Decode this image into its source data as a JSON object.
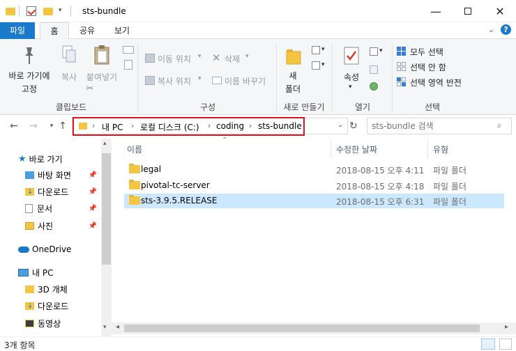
{
  "window": {
    "title": "sts-bundle",
    "controls": [
      "minimize",
      "maximize",
      "close"
    ]
  },
  "ribbon_tabs": [
    {
      "label": "파일",
      "active": false,
      "accent": true
    },
    {
      "label": "홈",
      "active": true
    },
    {
      "label": "공유",
      "active": false
    },
    {
      "label": "보기",
      "active": false
    }
  ],
  "ribbon": {
    "clipboard": {
      "pin_label_1": "바로 가기에",
      "pin_label_2": "고정",
      "copy": "복사",
      "paste": "붙여넣기",
      "group": "클립보드"
    },
    "organize": {
      "move_to": "이동 위치",
      "copy_to": "복사 위치",
      "delete": "삭제",
      "rename": "이름 바꾸기",
      "group": "구성"
    },
    "new": {
      "new_folder_1": "새",
      "new_folder_2": "폴더",
      "group": "새로 만들기"
    },
    "open": {
      "properties": "속성",
      "group": "열기"
    },
    "select": {
      "select_all": "모두 선택",
      "select_none": "선택 안 함",
      "invert": "선택 영역 반전",
      "group": "선택"
    }
  },
  "address": {
    "crumbs": [
      "내 PC",
      "로컬 디스크 (C:)",
      "coding",
      "sts-bundle"
    ],
    "search_placeholder": "sts-bundle 검색",
    "highlight_color": "#e0141e"
  },
  "nav_pane": {
    "quick_access": "바로 가기",
    "items": [
      {
        "label": "바탕 화면",
        "pinned": true,
        "icon": "desktop-folder-icon"
      },
      {
        "label": "다운로드",
        "pinned": true,
        "icon": "downloads-folder-icon"
      },
      {
        "label": "문서",
        "pinned": true,
        "icon": "documents-folder-icon"
      },
      {
        "label": "사진",
        "pinned": true,
        "icon": "pictures-folder-icon"
      }
    ],
    "onedrive": "OneDrive",
    "this_pc": "내 PC",
    "pc_items": [
      {
        "label": "3D 개체",
        "icon": "3d-objects-folder-icon"
      },
      {
        "label": "다운로드",
        "icon": "downloads-folder-icon"
      },
      {
        "label": "동영상",
        "icon": "videos-folder-icon"
      }
    ]
  },
  "file_list": {
    "columns": [
      "이름",
      "수정한 날짜",
      "유형"
    ],
    "rows": [
      {
        "name": "legal",
        "modified": "2018-08-15 오후 4:11",
        "type": "파일 폴더",
        "selected": false
      },
      {
        "name": "pivotal-tc-server",
        "modified": "2018-08-15 오후 4:18",
        "type": "파일 폴더",
        "selected": false
      },
      {
        "name": "sts-3.9.5.RELEASE",
        "modified": "2018-08-15 오후 6:31",
        "type": "파일 폴더",
        "selected": true
      }
    ]
  },
  "status": {
    "item_count": "3개 항목"
  },
  "colors": {
    "accent": "#1979ca",
    "selection": "#cce8ff",
    "folder": "#f4c542"
  }
}
